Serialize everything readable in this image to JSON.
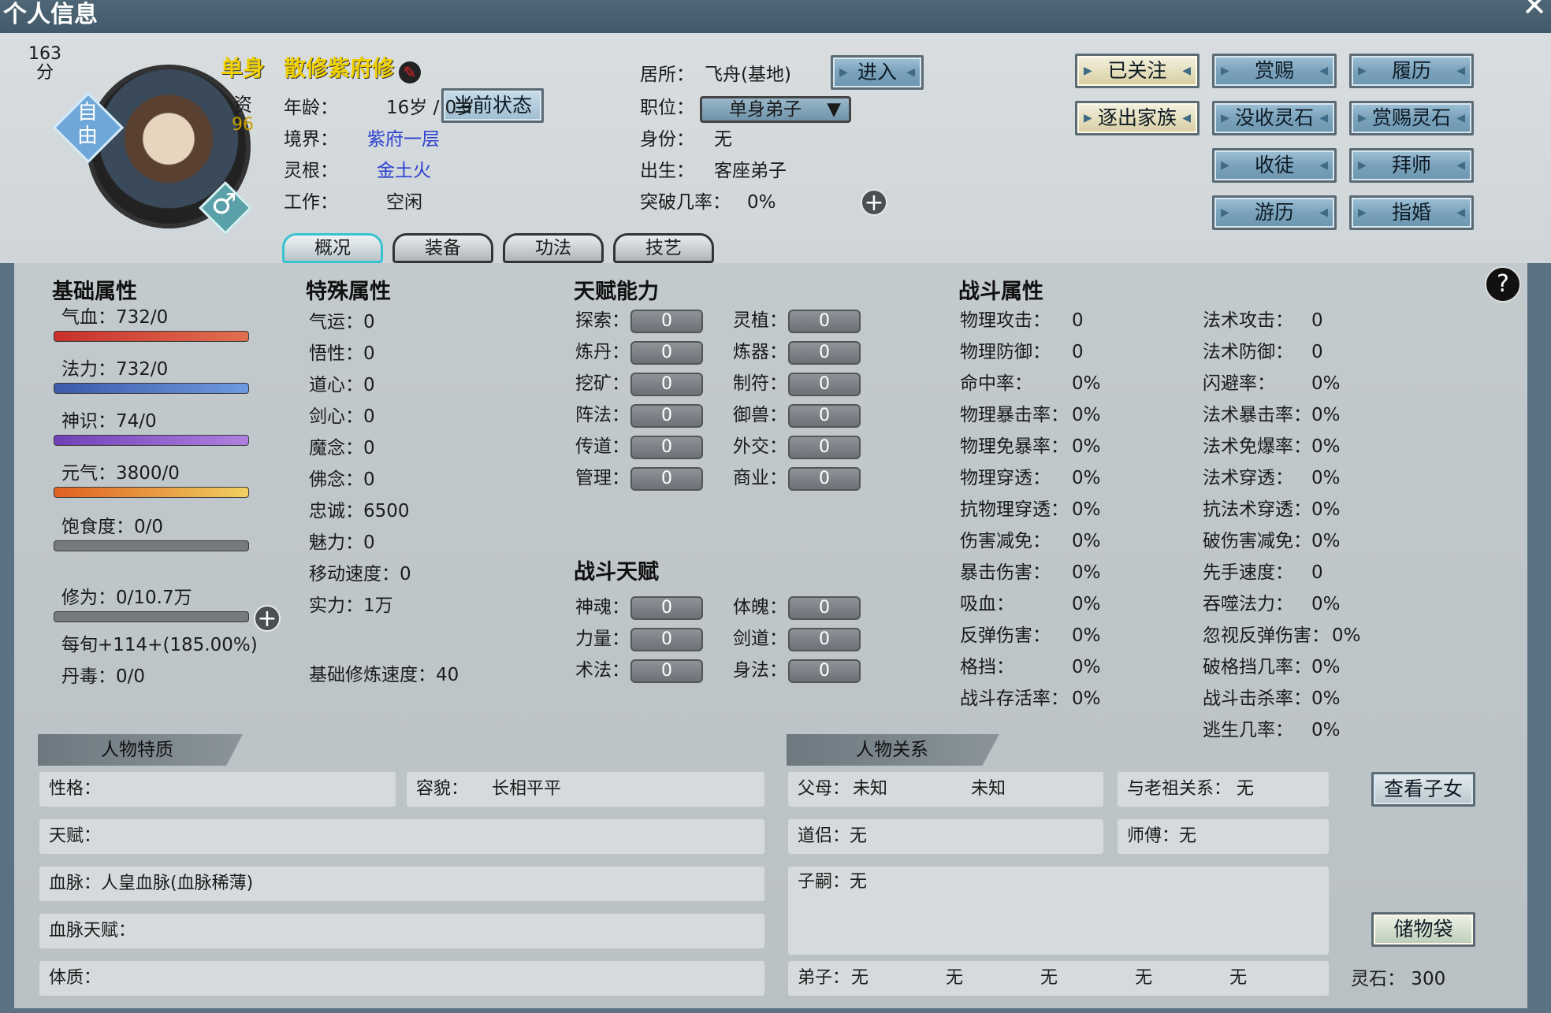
{
  "window": {
    "title": "个人信息",
    "close": "✕"
  },
  "profile": {
    "score_value": "163",
    "score_unit": "分",
    "status_badge": "自由",
    "gender_icon": "male-icon",
    "aptitude_label": "资",
    "aptitude_value": "96",
    "marital": "单身",
    "title_name": "散修紫府修",
    "current_status_button": "当前状态",
    "age_label": "年龄：",
    "age": "16岁 / 0岁",
    "realm_label": "境界：",
    "realm": "紫府一层",
    "root_label": "灵根：",
    "root": "金土火",
    "job_label": "工作：",
    "job": "空闲",
    "residence_label": "居所：",
    "residence": "飞舟(基地)",
    "enter_button": "进入",
    "position_label": "职位：",
    "position": "单身弟子",
    "identity_label": "身份：",
    "identity": "无",
    "birth_label": "出生：",
    "birth": "客座弟子",
    "breakthrough_label": "突破几率：",
    "breakthrough": "0%"
  },
  "actions": [
    "已关注",
    "赏赐",
    "履历",
    "逐出家族",
    "没收灵石",
    "赏赐灵石",
    "收徒",
    "拜师",
    "游历",
    "指婚"
  ],
  "tabs": [
    "概况",
    "装备",
    "功法",
    "技艺"
  ],
  "basic": {
    "title": "基础属性",
    "hp": "气血：732/0",
    "mp": "法力：732/0",
    "sense": "神识：74/0",
    "vital": "元气：3800/0",
    "food": "饱食度：0/0",
    "cultivation": "修为：0/10.7万",
    "per_turn": "每旬+114+(185.00%)",
    "poison": "丹毒：0/0"
  },
  "special": {
    "title": "特殊属性",
    "items": [
      "气运：0",
      "悟性：0",
      "道心：0",
      "剑心：0",
      "魔念：0",
      "佛念：0",
      "忠诚：6500",
      "魅力：0",
      "移动速度：0",
      "实力：1万"
    ],
    "base_speed": "基础修炼速度：40"
  },
  "talent": {
    "title": "天赋能力",
    "left": [
      [
        "探索：",
        "0"
      ],
      [
        "炼丹：",
        "0"
      ],
      [
        "挖矿：",
        "0"
      ],
      [
        "阵法：",
        "0"
      ],
      [
        "传道：",
        "0"
      ],
      [
        "管理：",
        "0"
      ]
    ],
    "right": [
      [
        "灵植：",
        "0"
      ],
      [
        "炼器：",
        "0"
      ],
      [
        "制符：",
        "0"
      ],
      [
        "御兽：",
        "0"
      ],
      [
        "外交：",
        "0"
      ],
      [
        "商业：",
        "0"
      ]
    ]
  },
  "battle_talent": {
    "title": "战斗天赋",
    "left": [
      [
        "神魂：",
        "0"
      ],
      [
        "力量：",
        "0"
      ],
      [
        "术法：",
        "0"
      ]
    ],
    "right": [
      [
        "体魄：",
        "0"
      ],
      [
        "剑道：",
        "0"
      ],
      [
        "身法：",
        "0"
      ]
    ]
  },
  "combat": {
    "title": "战斗属性",
    "left": [
      [
        "物理攻击：",
        "0"
      ],
      [
        "物理防御：",
        "0"
      ],
      [
        "命中率：",
        "0%"
      ],
      [
        "物理暴击率：",
        "0%"
      ],
      [
        "物理免暴率：",
        "0%"
      ],
      [
        "物理穿透：",
        "0%"
      ],
      [
        "抗物理穿透：",
        "0%"
      ],
      [
        "伤害减免：",
        "0%"
      ],
      [
        "暴击伤害：",
        "0%"
      ],
      [
        "吸血：",
        "0%"
      ],
      [
        "反弹伤害：",
        "0%"
      ],
      [
        "格挡：",
        "0%"
      ],
      [
        "战斗存活率：",
        "0%"
      ]
    ],
    "right": [
      [
        "法术攻击：",
        "0"
      ],
      [
        "法术防御：",
        "0"
      ],
      [
        "闪避率：",
        "0%"
      ],
      [
        "法术暴击率：",
        "0%"
      ],
      [
        "法术免爆率：",
        "0%"
      ],
      [
        "法术穿透：",
        "0%"
      ],
      [
        "抗法术穿透：",
        "0%"
      ],
      [
        "破伤害减免：",
        "0%"
      ],
      [
        "先手速度：",
        "0"
      ],
      [
        "吞噬法力：",
        "0%"
      ],
      [
        "忽视反弹伤害：",
        "0%"
      ],
      [
        "破格挡几率：",
        "0%"
      ],
      [
        "战斗击杀率：",
        "0%"
      ],
      [
        "逃生几率：",
        "0%"
      ]
    ]
  },
  "traits": {
    "title": "人物特质",
    "personality": "性格：",
    "looks_label": "容貌：",
    "looks": "长相平平",
    "gift": "天赋：",
    "bloodline": "血脉：人皇血脉(血脉稀薄)",
    "bloodline_gift": "血脉天赋：",
    "physique": "体质："
  },
  "relations": {
    "title": "人物关系",
    "parents_label": "父母：",
    "parent1": "未知",
    "parent2": "未知",
    "ancestor": "与老祖关系：  无",
    "partner": "道侣：无",
    "master": "师傅：无",
    "children": "子嗣：无",
    "disciples_label": "弟子：",
    "disciples": [
      "无",
      "无",
      "无",
      "无",
      "无"
    ],
    "view_children": "查看子女",
    "bag": "储物袋",
    "spirit_stone": "灵石：  300"
  },
  "help": "?",
  "colors": {
    "hp": "#c83c32",
    "mp": "#4f72c2",
    "sense": "#9060c8",
    "vital": "#e0a030",
    "link": "#2a3fd0",
    "gold_text": "#f0d000"
  }
}
